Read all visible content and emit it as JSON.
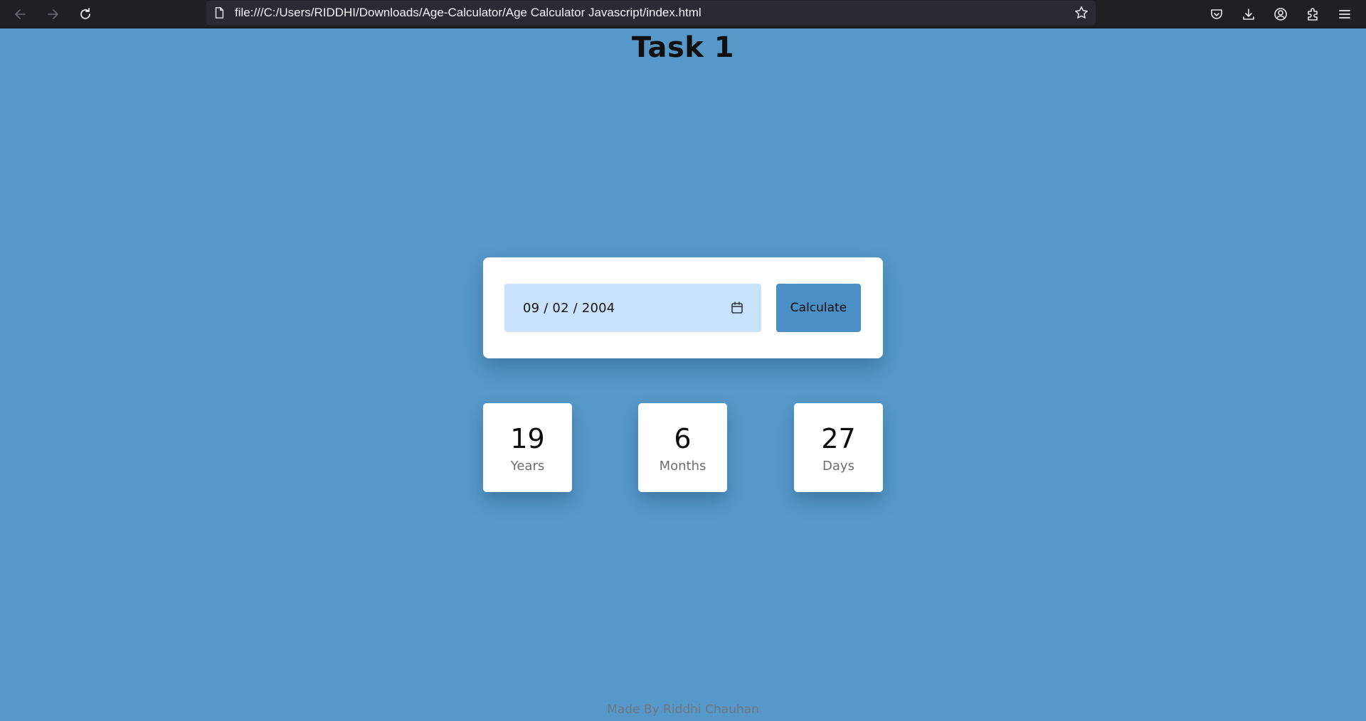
{
  "browser": {
    "url": "file:///C:/Users/RIDDHI/Downloads/Age-Calculator/Age Calculator Javascript/index.html",
    "icons": [
      "back-arrow-icon",
      "forward-arrow-icon",
      "reload-icon",
      "page-icon",
      "star-icon",
      "pocket-icon",
      "download-icon",
      "account-icon",
      "extensions-icon",
      "menu-icon"
    ]
  },
  "page": {
    "title": "Task 1",
    "date_input": {
      "value": "09 / 02 / 2004",
      "icon": "calendar-icon"
    },
    "calculate_label": "Calculate",
    "results": [
      {
        "value": "19",
        "label": "Years"
      },
      {
        "value": "6",
        "label": "Months"
      },
      {
        "value": "27",
        "label": "Days"
      }
    ],
    "footer": "Made By Riddhi Chauhan"
  },
  "colors": {
    "background": "#5699c9",
    "input_bg": "#c7e2fa",
    "button_bg": "#4a90c7",
    "card_bg": "#ffffff",
    "toolbar_bg": "#1f1f24"
  }
}
